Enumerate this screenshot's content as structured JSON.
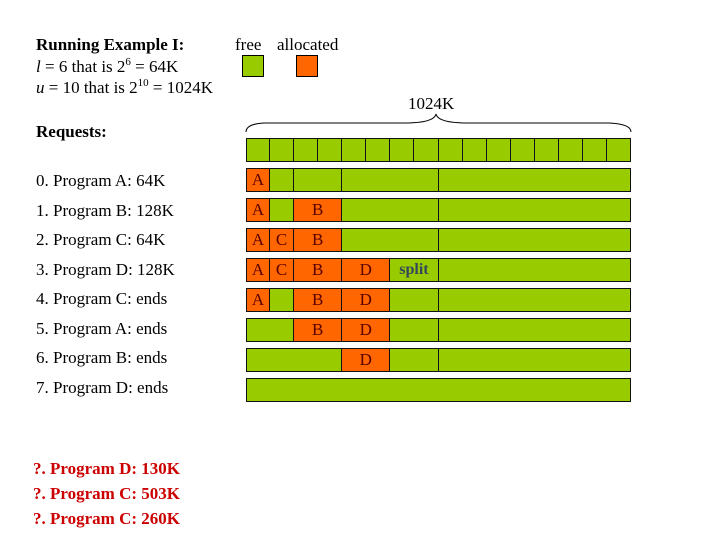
{
  "header": {
    "title": "Running Example I:",
    "l_var": "l",
    "l_text": " = 6 that is 2",
    "l_exp": "6",
    "l_tail": " = 64K",
    "u_var": "u",
    "u_text": " = 10 that is 2",
    "u_exp": "10",
    "u_tail": " = 1024K"
  },
  "legend": {
    "free_label": "free",
    "allocated_label": "allocated",
    "free_color": "#99CC00",
    "allocated_color": "#FF6600"
  },
  "total_label": "1024K",
  "requests_heading": "Requests:",
  "requests": [
    "0. Program A: 64K",
    "1. Program B: 128K",
    "2. Program C: 64K",
    "3. Program D: 128K",
    "4. Program C: ends",
    "5. Program A: ends",
    "6. Program B: ends",
    "7. Program D: ends"
  ],
  "questions": [
    "?. Program D: 130K",
    "?. Program C: 503K",
    "?. Program C: 260K"
  ],
  "memory": {
    "unit_k": 64,
    "total_k": 1024,
    "grid_cells": 16,
    "rows": [
      [
        {
          "size": 64,
          "label": "A",
          "state": "allocated"
        },
        {
          "size": 64,
          "label": "",
          "state": "free"
        },
        {
          "size": 128,
          "label": "",
          "state": "free"
        },
        {
          "size": 256,
          "label": "",
          "state": "free"
        },
        {
          "size": 512,
          "label": "",
          "state": "free"
        }
      ],
      [
        {
          "size": 64,
          "label": "A",
          "state": "allocated"
        },
        {
          "size": 64,
          "label": "",
          "state": "free"
        },
        {
          "size": 128,
          "label": "B",
          "state": "allocated"
        },
        {
          "size": 256,
          "label": "",
          "state": "free"
        },
        {
          "size": 512,
          "label": "",
          "state": "free"
        }
      ],
      [
        {
          "size": 64,
          "label": "A",
          "state": "allocated"
        },
        {
          "size": 64,
          "label": "C",
          "state": "allocated"
        },
        {
          "size": 128,
          "label": "B",
          "state": "allocated"
        },
        {
          "size": 256,
          "label": "",
          "state": "free"
        },
        {
          "size": 512,
          "label": "",
          "state": "free"
        }
      ],
      [
        {
          "size": 64,
          "label": "A",
          "state": "allocated"
        },
        {
          "size": 64,
          "label": "C",
          "state": "allocated"
        },
        {
          "size": 128,
          "label": "B",
          "state": "allocated"
        },
        {
          "size": 128,
          "label": "D",
          "state": "allocated"
        },
        {
          "size": 128,
          "label": "split",
          "state": "free",
          "note": true
        },
        {
          "size": 512,
          "label": "",
          "state": "free"
        }
      ],
      [
        {
          "size": 64,
          "label": "A",
          "state": "allocated"
        },
        {
          "size": 64,
          "label": "",
          "state": "free"
        },
        {
          "size": 128,
          "label": "B",
          "state": "allocated"
        },
        {
          "size": 128,
          "label": "D",
          "state": "allocated"
        },
        {
          "size": 128,
          "label": "",
          "state": "free"
        },
        {
          "size": 512,
          "label": "",
          "state": "free"
        }
      ],
      [
        {
          "size": 128,
          "label": "",
          "state": "free"
        },
        {
          "size": 128,
          "label": "B",
          "state": "allocated"
        },
        {
          "size": 128,
          "label": "D",
          "state": "allocated"
        },
        {
          "size": 128,
          "label": "",
          "state": "free"
        },
        {
          "size": 512,
          "label": "",
          "state": "free"
        }
      ],
      [
        {
          "size": 256,
          "label": "",
          "state": "free"
        },
        {
          "size": 128,
          "label": "D",
          "state": "allocated"
        },
        {
          "size": 128,
          "label": "",
          "state": "free"
        },
        {
          "size": 512,
          "label": "",
          "state": "free"
        }
      ],
      [
        {
          "size": 1024,
          "label": "",
          "state": "free"
        }
      ]
    ]
  }
}
